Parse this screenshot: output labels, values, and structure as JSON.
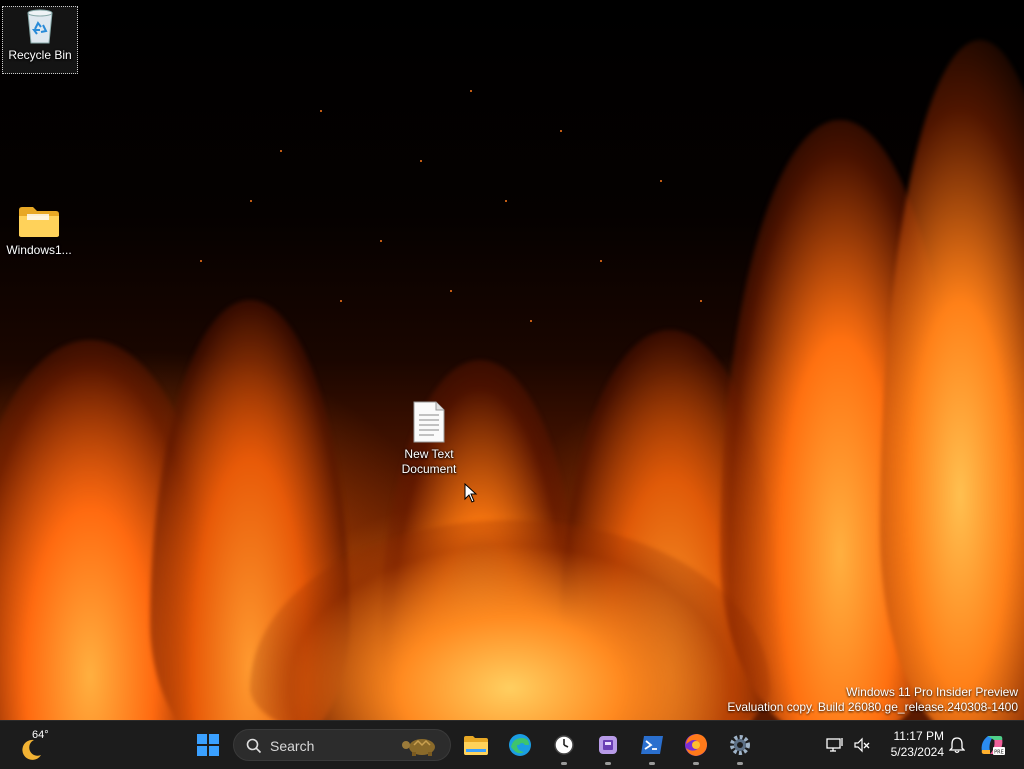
{
  "desktop": {
    "icons": [
      {
        "label": "Recycle Bin",
        "icon": "recycle-bin-icon"
      },
      {
        "label": "Windows1...",
        "icon": "folder-icon"
      },
      {
        "label": "New Text Document",
        "icon": "text-document-icon"
      }
    ],
    "watermark": {
      "line1": "Windows 11 Pro Insider Preview",
      "line2": "Evaluation copy. Build 26080.ge_release.240308-1400"
    }
  },
  "taskbar": {
    "weather": {
      "temp": "64°",
      "icon": "weather-moon-icon"
    },
    "search": {
      "placeholder": "Search"
    },
    "apps": [
      {
        "name": "start",
        "icon": "windows-start-icon"
      },
      {
        "name": "file-explorer",
        "icon": "folder-icon"
      },
      {
        "name": "edge",
        "icon": "edge-browser-icon"
      },
      {
        "name": "clock",
        "icon": "clock-icon"
      },
      {
        "name": "notepad-app",
        "icon": "app-icon"
      },
      {
        "name": "powershell",
        "icon": "terminal-icon"
      },
      {
        "name": "firefox",
        "icon": "firefox-icon"
      },
      {
        "name": "settings",
        "icon": "gear-icon"
      }
    ],
    "tray": {
      "time": "11:17 PM",
      "date": "5/23/2024"
    }
  },
  "colors": {
    "taskbar_bg": "#1c1c1c",
    "accent_blue": "#3aa0ff",
    "flame_orange": "#ff7a1a"
  }
}
